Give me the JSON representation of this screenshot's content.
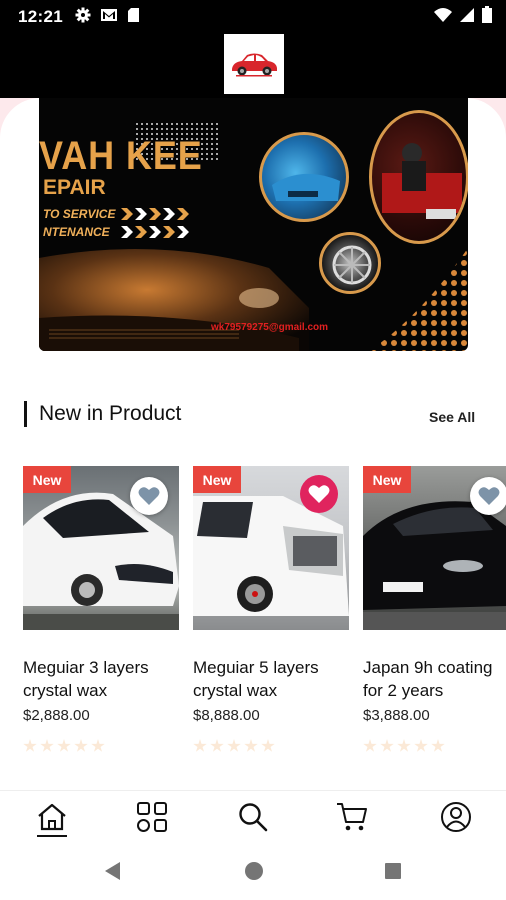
{
  "status_bar": {
    "time": "12:21",
    "icons": [
      "gear-icon",
      "gmail-icon",
      "sd-card-icon"
    ],
    "right_icons": [
      "wifi-icon",
      "signal-icon",
      "battery-icon"
    ]
  },
  "header": {
    "logo": "car-logo-icon"
  },
  "banner": {
    "title": "VAH KEE",
    "subtitle": "EPAIR",
    "line1": "TO SERVICE",
    "line2": "NTENANCE",
    "email": "wk79579275@gmail.com",
    "colors": {
      "accent": "#e6a24a",
      "background": "#050505"
    }
  },
  "section": {
    "title": "New in Product",
    "see_all": "See All"
  },
  "products": [
    {
      "badge": "New",
      "name_line1": "Meguiar 3 layers",
      "name_line2": "crystal wax",
      "price": "$2,888.00",
      "favorited": false,
      "rating": 0,
      "color": "white"
    },
    {
      "badge": "New",
      "name_line1": "Meguiar 5 layers",
      "name_line2": "crystal wax",
      "price": "$8,888.00",
      "favorited": true,
      "rating": 0,
      "color": "white"
    },
    {
      "badge": "New",
      "name_line1": "Japan 9h coating",
      "name_line2": "for 2 years",
      "price": "$3,888.00",
      "favorited": false,
      "rating": 0,
      "color": "black"
    }
  ],
  "bottom_nav": {
    "items": [
      "home-icon",
      "categories-icon",
      "search-icon",
      "cart-icon",
      "profile-icon"
    ],
    "active": "home-icon"
  },
  "system_nav": [
    "back-icon",
    "home-circle-icon",
    "recents-icon"
  ],
  "colors": {
    "badge": "#e8453c",
    "favorite_active": "#e0245e",
    "favorite_inactive": "#7d93a8",
    "star_empty": "#fbe9d7"
  }
}
